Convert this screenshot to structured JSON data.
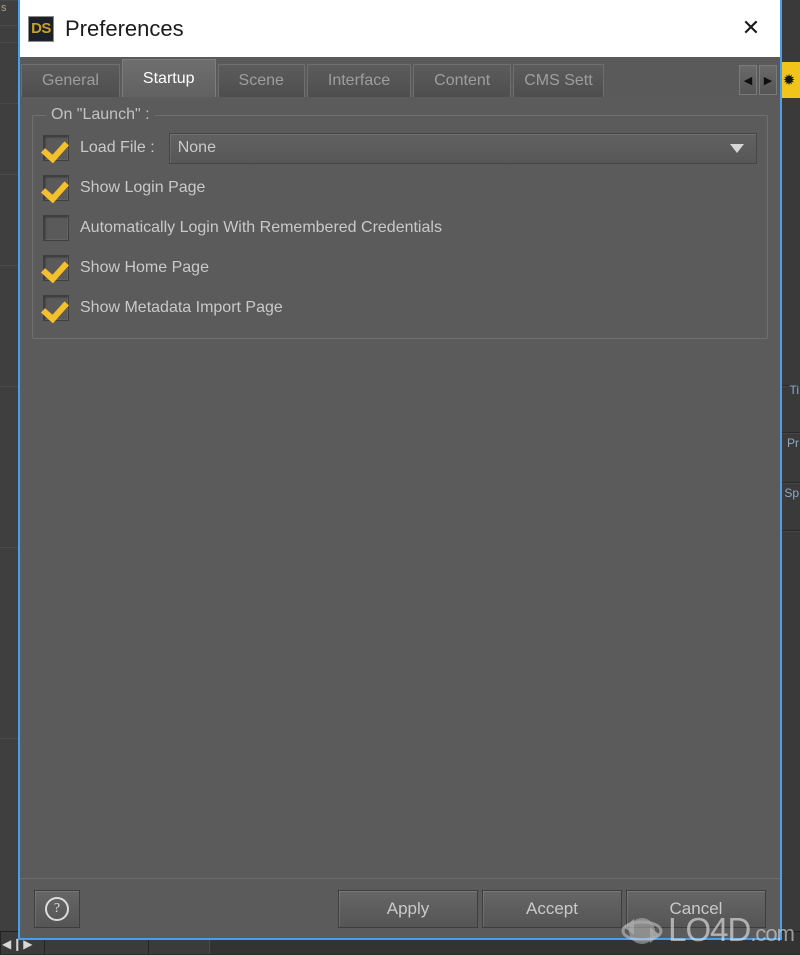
{
  "window": {
    "title": "Preferences",
    "logo_text": "DS",
    "logo_icon": "daz-studio-logo-icon",
    "close_icon": "close-icon"
  },
  "tabs": {
    "items": [
      {
        "label": "General",
        "active": false
      },
      {
        "label": "Startup",
        "active": true
      },
      {
        "label": "Scene",
        "active": false
      },
      {
        "label": "Interface",
        "active": false
      },
      {
        "label": "Content",
        "active": false
      },
      {
        "label": "CMS Sett",
        "active": false,
        "truncated": true
      }
    ],
    "scroll_left_icon": "chevron-left-icon",
    "scroll_right_icon": "chevron-right-icon",
    "scroll_left_glyph": "◀",
    "scroll_right_glyph": "▶"
  },
  "group": {
    "title": "On \"Launch\" :",
    "load_file": {
      "label": "Load File :",
      "checked": true,
      "dropdown_value": "None",
      "dropdown_arrow_icon": "chevron-down-icon"
    },
    "checkboxes": [
      {
        "label": "Show Login Page",
        "checked": true
      },
      {
        "label": "Automatically Login With Remembered Credentials",
        "checked": false
      },
      {
        "label": "Show Home Page",
        "checked": true
      },
      {
        "label": "Show Metadata Import Page",
        "checked": true
      }
    ]
  },
  "footer": {
    "help_label": "?",
    "help_icon": "help-circle-icon",
    "buttons": [
      {
        "label": "Apply"
      },
      {
        "label": "Accept"
      },
      {
        "label": "Cancel"
      }
    ]
  },
  "background": {
    "left_label": "s",
    "right_labels": [
      "Ti",
      "Pr",
      "Sp"
    ],
    "right_icon": "pin-icon",
    "right_icon_glyph": "✹",
    "bottom_arrows": "◀❙▶"
  },
  "watermark": {
    "name": "LO4D",
    "suffix": ".com",
    "logo_icon": "refresh-circle-icon"
  },
  "colors": {
    "accent_border": "#4a9eea",
    "checkmark": "#f5c02c",
    "logo_gold": "#c8a02a",
    "panel_bg": "#5b5b5b",
    "titlebar_bg": "#ffffff"
  }
}
